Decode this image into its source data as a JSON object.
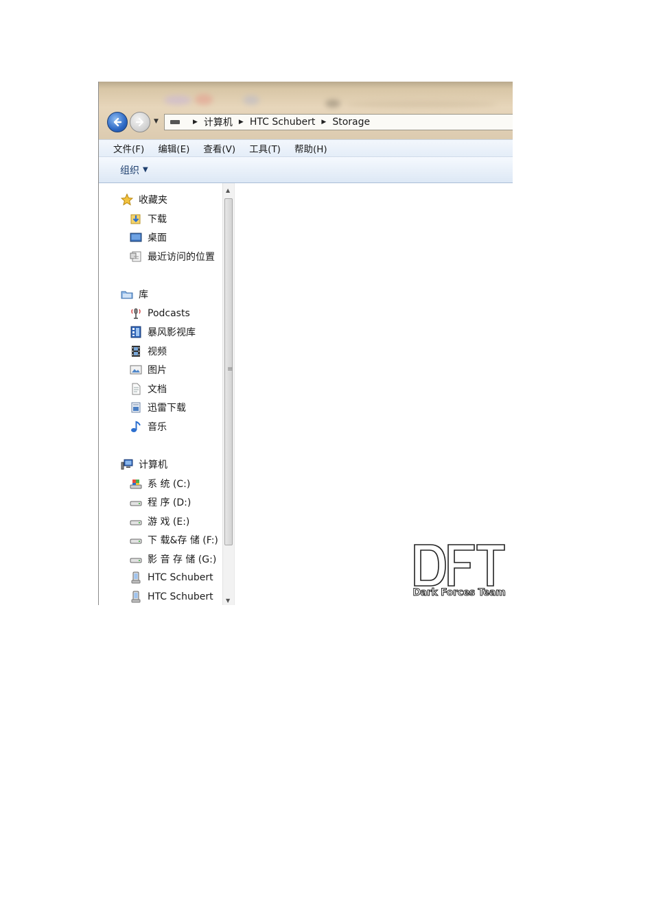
{
  "address_bar": {
    "breadcrumbs": [
      "计算机",
      "HTC Schubert",
      "Storage"
    ]
  },
  "menu": {
    "items": [
      "文件(F)",
      "编辑(E)",
      "查看(V)",
      "工具(T)",
      "帮助(H)"
    ]
  },
  "toolbar": {
    "organize_label": "组织"
  },
  "nav_pane": {
    "favorites": {
      "label": "收藏夹",
      "items": [
        "下载",
        "桌面",
        "最近访问的位置"
      ]
    },
    "libraries": {
      "label": "库",
      "items": [
        "Podcasts",
        "暴风影视库",
        "视频",
        "图片",
        "文档",
        "迅雷下载",
        "音乐"
      ]
    },
    "computer": {
      "label": "计算机",
      "items": [
        "系 统 (C:)",
        "程 序 (D:)",
        "游 戏 (E:)",
        "下 载&存 储 (F:)",
        "影 音 存 储 (G:)",
        "HTC Schubert",
        "HTC Schubert"
      ]
    },
    "selected_item": "HTC Schubert"
  },
  "watermark": {
    "text": "Dark Forces Team"
  },
  "colors": {
    "titlebar": "#dccbb0",
    "menubar": "#e4edf8",
    "toolbar_text": "#1e3f6e",
    "selection": "#ececec"
  }
}
